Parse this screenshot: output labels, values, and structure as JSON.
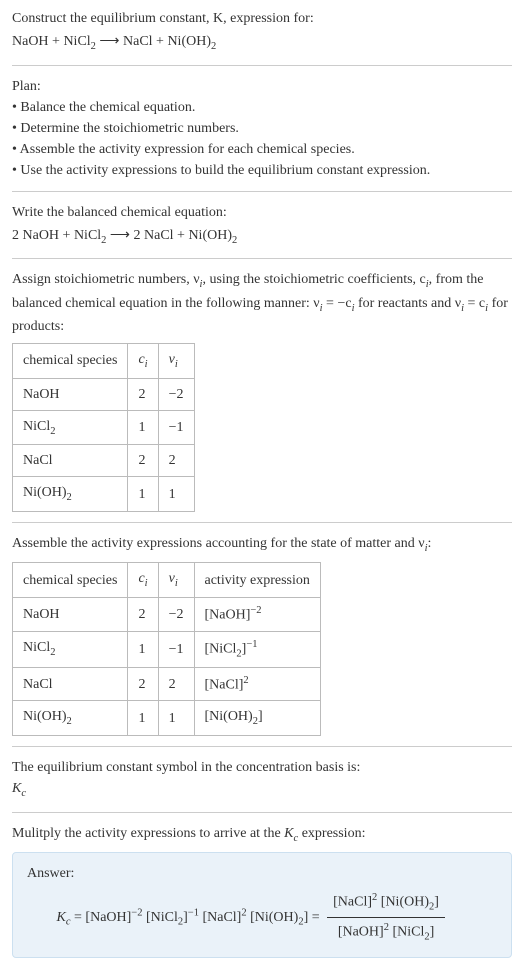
{
  "header": {
    "line1": "Construct the equilibrium constant, K, expression for:",
    "reaction_lhs_1": "NaOH + NiCl",
    "reaction_lhs_1_sub": "2",
    "arrow": " ⟶ ",
    "reaction_rhs_1": "NaCl + Ni(OH)",
    "reaction_rhs_1_sub": "2"
  },
  "plan": {
    "title": "Plan:",
    "b1": "• Balance the chemical equation.",
    "b2": "• Determine the stoichiometric numbers.",
    "b3": "• Assemble the activity expression for each chemical species.",
    "b4": "• Use the activity expressions to build the equilibrium constant expression."
  },
  "balanced": {
    "title": "Write the balanced chemical equation:",
    "lhs_a": "2 NaOH + NiCl",
    "lhs_a_sub": "2",
    "arrow": " ⟶ ",
    "rhs_a": "2 NaCl + Ni(OH)",
    "rhs_a_sub": "2"
  },
  "assign": {
    "text_a": "Assign stoichiometric numbers, ν",
    "text_a_sub": "i",
    "text_b": ", using the stoichiometric coefficients, c",
    "text_b_sub": "i",
    "text_c": ", from the balanced chemical equation in the following manner: ν",
    "text_c_sub": "i",
    "text_d": " = −c",
    "text_d_sub": "i",
    "text_e": " for reactants and ν",
    "text_e_sub": "i",
    "text_f": " = c",
    "text_f_sub": "i",
    "text_g": " for products:"
  },
  "table1": {
    "h1": "chemical species",
    "h2_a": "c",
    "h2_b": "i",
    "h3_a": "ν",
    "h3_b": "i",
    "r1c1": "NaOH",
    "r1c2": "2",
    "r1c3": "−2",
    "r2c1a": "NiCl",
    "r2c1b": "2",
    "r2c2": "1",
    "r2c3": "−1",
    "r3c1": "NaCl",
    "r3c2": "2",
    "r3c3": "2",
    "r4c1a": "Ni(OH)",
    "r4c1b": "2",
    "r4c2": "1",
    "r4c3": "1"
  },
  "assemble": {
    "text_a": "Assemble the activity expressions accounting for the state of matter and ν",
    "text_a_sub": "i",
    "text_b": ":"
  },
  "table2": {
    "h1": "chemical species",
    "h2_a": "c",
    "h2_b": "i",
    "h3_a": "ν",
    "h3_b": "i",
    "h4": "activity expression",
    "r1c1": "NaOH",
    "r1c2": "2",
    "r1c3": "−2",
    "r1c4_base": "[NaOH]",
    "r1c4_sup": "−2",
    "r2c1a": "NiCl",
    "r2c1b": "2",
    "r2c2": "1",
    "r2c3": "−1",
    "r2c4_base_a": "[NiCl",
    "r2c4_base_b": "2",
    "r2c4_base_c": "]",
    "r2c4_sup": "−1",
    "r3c1": "NaCl",
    "r3c2": "2",
    "r3c3": "2",
    "r3c4_base": "[NaCl]",
    "r3c4_sup": "2",
    "r4c1a": "Ni(OH)",
    "r4c1b": "2",
    "r4c2": "1",
    "r4c3": "1",
    "r4c4_base_a": "[Ni(OH)",
    "r4c4_base_b": "2",
    "r4c4_base_c": "]"
  },
  "eqsym": {
    "line1": "The equilibrium constant symbol in the concentration basis is:",
    "k": "K",
    "ksub": "c"
  },
  "multiply": {
    "text_a": "Mulitply the activity expressions to arrive at the ",
    "k": "K",
    "ksub": "c",
    "text_b": " expression:"
  },
  "answer": {
    "label": "Answer:",
    "k": "K",
    "ksub": "c",
    "eq": " = ",
    "t1": "[NaOH]",
    "t1s": "−2",
    "t2a": " [NiCl",
    "t2b": "2",
    "t2c": "]",
    "t2s": "−1",
    "t3": " [NaCl]",
    "t3s": "2",
    "t4a": " [Ni(OH)",
    "t4b": "2",
    "t4c": "]",
    "eq2": " = ",
    "num_a": "[NaCl]",
    "num_as": "2",
    "num_b": " [Ni(OH)",
    "num_bs": "2",
    "num_c": "]",
    "den_a": "[NaOH]",
    "den_as": "2",
    "den_b": " [NiCl",
    "den_bs": "2",
    "den_c": "]"
  },
  "chart_data": {
    "type": "table",
    "tables": [
      {
        "title": "Stoichiometric coefficients and numbers",
        "columns": [
          "chemical species",
          "c_i",
          "ν_i"
        ],
        "rows": [
          [
            "NaOH",
            2,
            -2
          ],
          [
            "NiCl2",
            1,
            -1
          ],
          [
            "NaCl",
            2,
            2
          ],
          [
            "Ni(OH)2",
            1,
            1
          ]
        ]
      },
      {
        "title": "Activity expressions",
        "columns": [
          "chemical species",
          "c_i",
          "ν_i",
          "activity expression"
        ],
        "rows": [
          [
            "NaOH",
            2,
            -2,
            "[NaOH]^-2"
          ],
          [
            "NiCl2",
            1,
            -1,
            "[NiCl2]^-1"
          ],
          [
            "NaCl",
            2,
            2,
            "[NaCl]^2"
          ],
          [
            "Ni(OH)2",
            1,
            1,
            "[Ni(OH)2]"
          ]
        ]
      }
    ]
  }
}
